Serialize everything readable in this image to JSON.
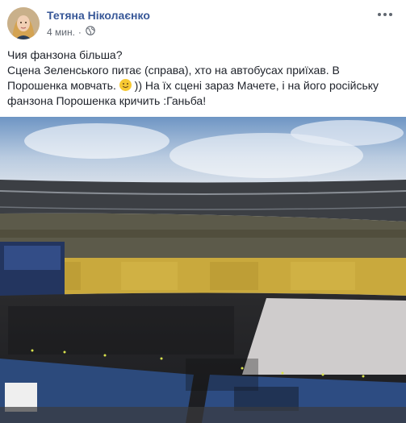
{
  "post": {
    "author": "Тетяна Ніколаєнко",
    "time": "4 мин.",
    "separator": "·",
    "privacy_icon": "globe-icon",
    "more_icon": "more-options-icon",
    "text_lines": [
      "Чия фанзона більша?",
      "Сцена Зеленського питає (справа), хто на автобусах приїхав. В",
      "Порошенка мовчать.",
      ")) На їх сцені зараз Мачете, і на його російську",
      "фанзона Порошенка кричить :Ганьба!"
    ],
    "emoji_icon": "smiley-emoji-icon"
  },
  "photo": {
    "subject": "stadium-crowd-photo"
  }
}
